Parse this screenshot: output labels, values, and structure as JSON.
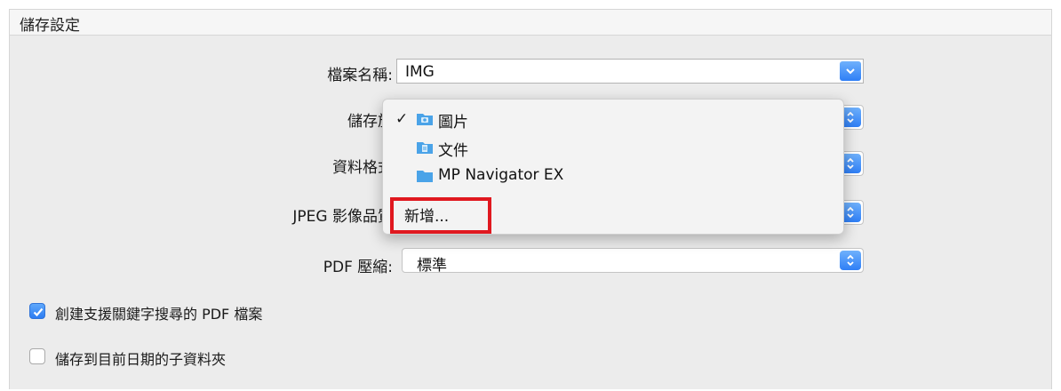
{
  "section": {
    "title": "儲存設定"
  },
  "form": {
    "filename_label": "檔案名稱:",
    "filename_value": "IMG",
    "save_in_label": "儲存於",
    "data_format_label": "資料格式",
    "jpeg_quality_label": "JPEG 影像品質",
    "pdf_compression_label": "PDF 壓縮:",
    "pdf_compression_value": "標準"
  },
  "menu": {
    "items": [
      {
        "label": "圖片",
        "checked": true,
        "icon": "pictures-folder-icon"
      },
      {
        "label": "文件",
        "checked": false,
        "icon": "documents-folder-icon"
      },
      {
        "label": "MP Navigator EX",
        "checked": false,
        "icon": "folder-icon"
      }
    ],
    "add_label": "新增...",
    "check_mark": "✓"
  },
  "options": {
    "keyword_pdf_label": "創建支援關鍵字搜尋的 PDF 檔案",
    "keyword_pdf_checked": true,
    "date_subfolder_label": "儲存到目前日期的子資料夾",
    "date_subfolder_checked": false
  },
  "colors": {
    "accent": "#2f7ff6",
    "highlight": "#e0181f",
    "folder": "#4aa3e8"
  }
}
